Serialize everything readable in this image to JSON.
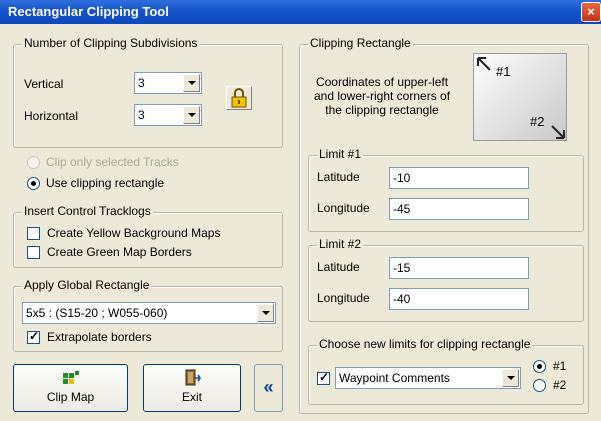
{
  "window": {
    "title": "Rectangular Clipping Tool",
    "close": "×"
  },
  "subdivisions": {
    "legend": "Number of Clipping Subdivisions",
    "vertical_label": "Vertical",
    "vertical_value": "3",
    "horizontal_label": "Horizontal",
    "horizontal_value": "3",
    "lock_icon": "padlock-icon"
  },
  "mode": {
    "clip_selected_label": "Clip only selected Tracks",
    "use_rect_label": "Use clipping rectangle"
  },
  "control_tracklogs": {
    "legend": "Insert Control Tracklogs",
    "yellow_label": "Create Yellow Background Maps",
    "green_label": "Create Green Map Borders"
  },
  "global_rect": {
    "legend": "Apply Global Rectangle",
    "selected": "5x5 : (S15-20 ; W055-060)",
    "extrapolate_label": "Extrapolate borders"
  },
  "buttons": {
    "clip_map_label": "Clip Map",
    "exit_label": "Exit",
    "collapse_label": "«"
  },
  "clipping_rect": {
    "legend": "Clipping Rectangle",
    "description": [
      "Coordinates of upper-left",
      "and lower-right corners of",
      "the clipping rectangle"
    ],
    "corner1": "#1",
    "corner2": "#2"
  },
  "limit1": {
    "legend": "Limit #1",
    "lat_label": "Latitude",
    "lat_value": "-10",
    "lon_label": "Longitude",
    "lon_value": "-45"
  },
  "limit2": {
    "legend": "Limit #2",
    "lat_label": "Latitude",
    "lat_value": "-15",
    "lon_label": "Longitude",
    "lon_value": "-40"
  },
  "new_limits": {
    "legend": "Choose new limits for clipping rectangle",
    "source_selected": "Waypoint Comments",
    "radio1_label": "#1",
    "radio2_label": "#2"
  },
  "colors": {
    "titlebar": "#0d47be",
    "dialog_bg": "#ece9d8",
    "button_border": "#003c74",
    "lock_yellow": "#f4c400"
  }
}
